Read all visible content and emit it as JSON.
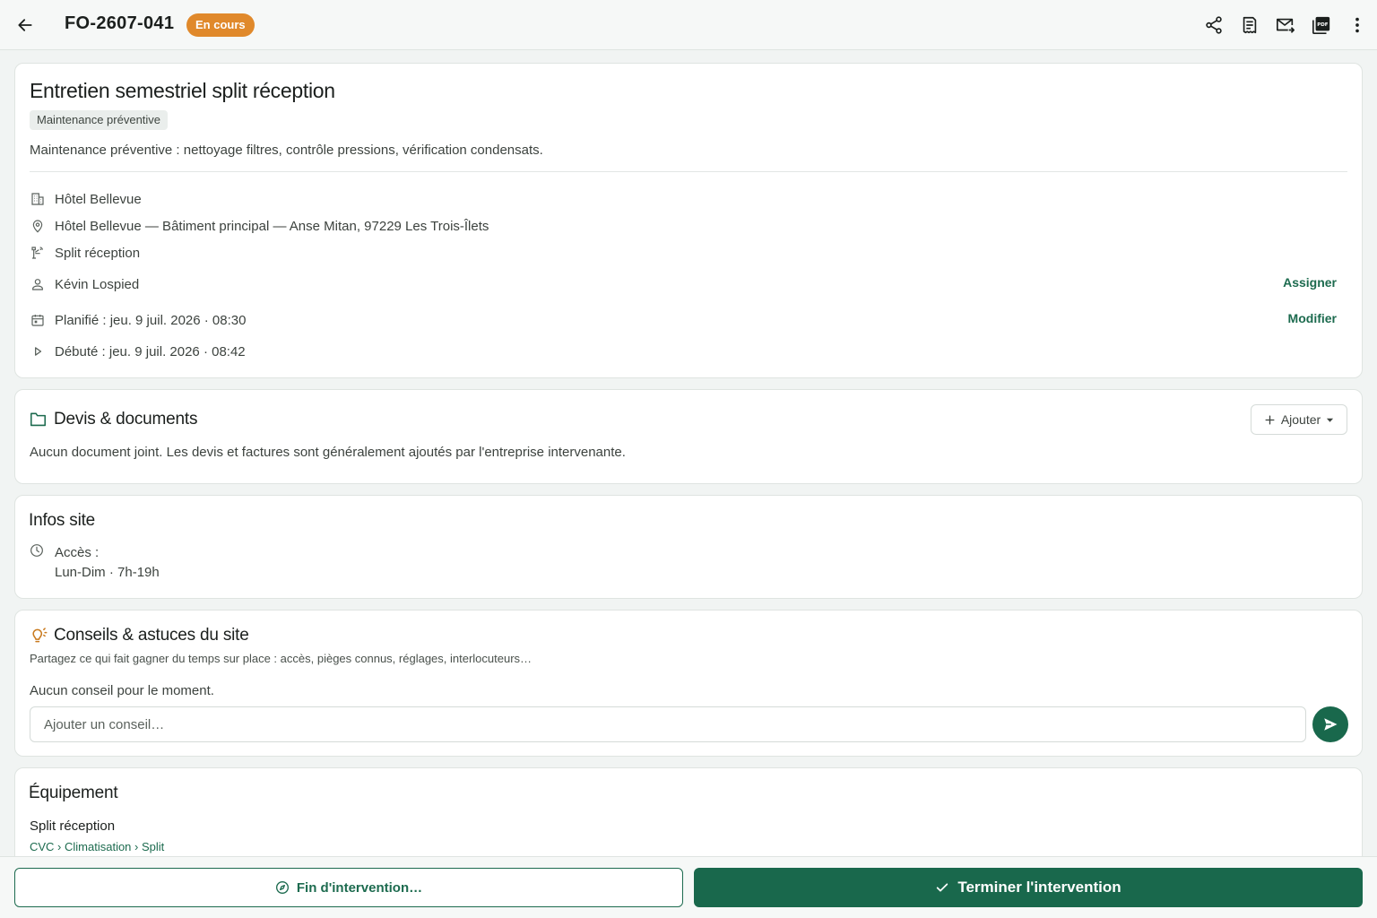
{
  "header": {
    "reference": "FO-2607-041",
    "status": "En cours",
    "actions": [
      {
        "icon": "share-icon"
      },
      {
        "icon": "receipt-icon"
      },
      {
        "icon": "mail-forward-icon"
      },
      {
        "icon": "pdf-icon"
      },
      {
        "icon": "more-vertical-icon"
      }
    ]
  },
  "intervention": {
    "title": "Entretien semestriel split réception",
    "type": "Maintenance préventive",
    "description": "Maintenance préventive : nettoyage filtres, contrôle pressions, vérification condensats.",
    "client": "Hôtel Bellevue",
    "address": "Hôtel Bellevue — Bâtiment principal — Anse Mitan, 97229 Les Trois-Îlets",
    "equipment": "Split réception",
    "assignee": "Kévin Lospied",
    "assign_label": "Assigner",
    "planned": "Planifié : jeu. 9 juil. 2026 · 08:30",
    "modify_label": "Modifier",
    "started": "Débuté : jeu. 9 juil. 2026 · 08:42"
  },
  "documents": {
    "title": "Devis & documents",
    "add_label": "Ajouter",
    "empty_text": "Aucun document joint. Les devis et factures sont généralement ajoutés par l'entreprise intervenante."
  },
  "site_info": {
    "title": "Infos site",
    "access_label": "Accès :",
    "access_hours": "Lun-Dim · 7h-19h"
  },
  "tips": {
    "title": "Conseils & astuces du site",
    "hint": "Partagez ce qui fait gagner du temps sur place : accès, pièges connus, réglages, interlocuteurs…",
    "empty_text": "Aucun conseil pour le moment.",
    "input_placeholder": "Ajouter un conseil…"
  },
  "equipment_section": {
    "title": "Équipement",
    "name": "Split réception",
    "category_path": "CVC › Climatisation › Split"
  },
  "footer": {
    "secondary_label": "Fin d'intervention…",
    "primary_label": "Terminer l'intervention"
  },
  "colors": {
    "accent": "#19684c",
    "status_badge": "#e0892b",
    "tips_icon": "#c97a1e"
  }
}
